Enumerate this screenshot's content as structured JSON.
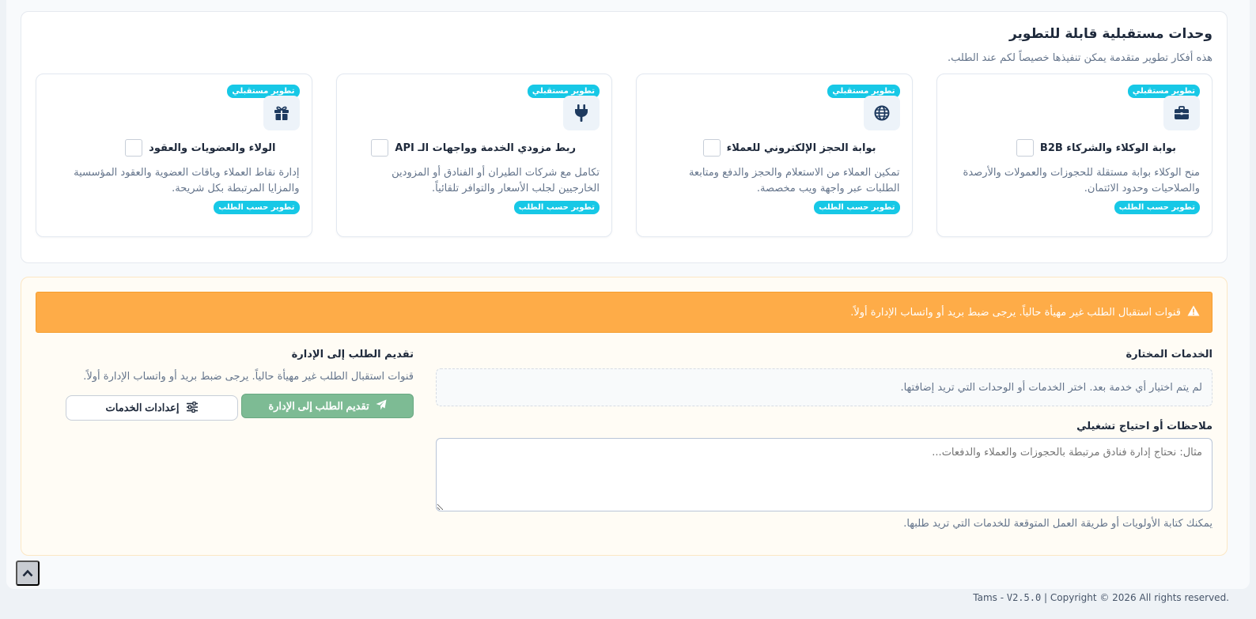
{
  "future_modules": {
    "title": "وحدات مستقبلية قابلة للتطوير",
    "subtitle": "هذه أفكار تطوير متقدمة يمكن تنفيذها خصيصاً لكم عند الطلب.",
    "items": [
      {
        "badge": "تطوير مستقبلي",
        "icon": "briefcase-icon",
        "title": "بوابة الوكلاء والشركاء B2B",
        "description": "منح الوكلاء بوابة مستقلة للحجوزات والعمولات والأرصدة والصلاحيات وحدود الائتمان.",
        "tag": "تطوير حسب الطلب"
      },
      {
        "badge": "تطوير مستقبلي",
        "icon": "globe-icon",
        "title": "بوابة الحجز الإلكتروني للعملاء",
        "description": "تمكين العملاء من الاستعلام والحجز والدفع ومتابعة الطلبات عبر واجهة ويب مخصصة.",
        "tag": "تطوير حسب الطلب"
      },
      {
        "badge": "تطوير مستقبلي",
        "icon": "plug-icon",
        "title": "ربط مزودي الخدمة وواجهات الـ API",
        "description": "تكامل مع شركات الطيران أو الفنادق أو المزودين الخارجيين لجلب الأسعار والتوافر تلقائياً.",
        "tag": "تطوير حسب الطلب"
      },
      {
        "badge": "تطوير مستقبلي",
        "icon": "gift-icon",
        "title": "الولاء والعضويات والعقود",
        "description": "إدارة نقاط العملاء وباقات العضوية والعقود المؤسسية والمزايا المرتبطة بكل شريحة.",
        "tag": "تطوير حسب الطلب"
      }
    ]
  },
  "request": {
    "alert": "قنوات استقبال الطلب غير مهيأة حالياً. يرجى ضبط بريد أو واتساب الإدارة أولاً.",
    "selected_label": "الخدمات المختارة",
    "selected_empty": "لم يتم اختيار أي خدمة بعد. اختر الخدمات أو الوحدات التي تريد إضافتها.",
    "notes_label": "ملاحظات أو احتياج تشغيلي",
    "notes_placeholder": "مثال: نحتاج إدارة فنادق مرتبطة بالحجوزات والعملاء والدفعات...",
    "notes_hint": "يمكنك كتابة الأولويات أو طريقة العمل المتوقعة للخدمات التي تريد طلبها.",
    "submit_title": "تقديم الطلب إلى الإدارة",
    "submit_text": "قنوات استقبال الطلب غير مهيأة حالياً. يرجى ضبط بريد أو واتساب الإدارة أولاً.",
    "submit_button": "تقديم الطلب إلى الإدارة",
    "settings_button": "إعدادات الخدمات"
  },
  "footer": {
    "brand": "Tams - ",
    "version": "V2.5.0",
    "copyright": " | Copyright © 2026 All rights reserved."
  },
  "colors": {
    "badge": "#17c8e6",
    "alert": "#feac48",
    "submit": "#7dbb94",
    "icon": "#1e3a5f"
  }
}
